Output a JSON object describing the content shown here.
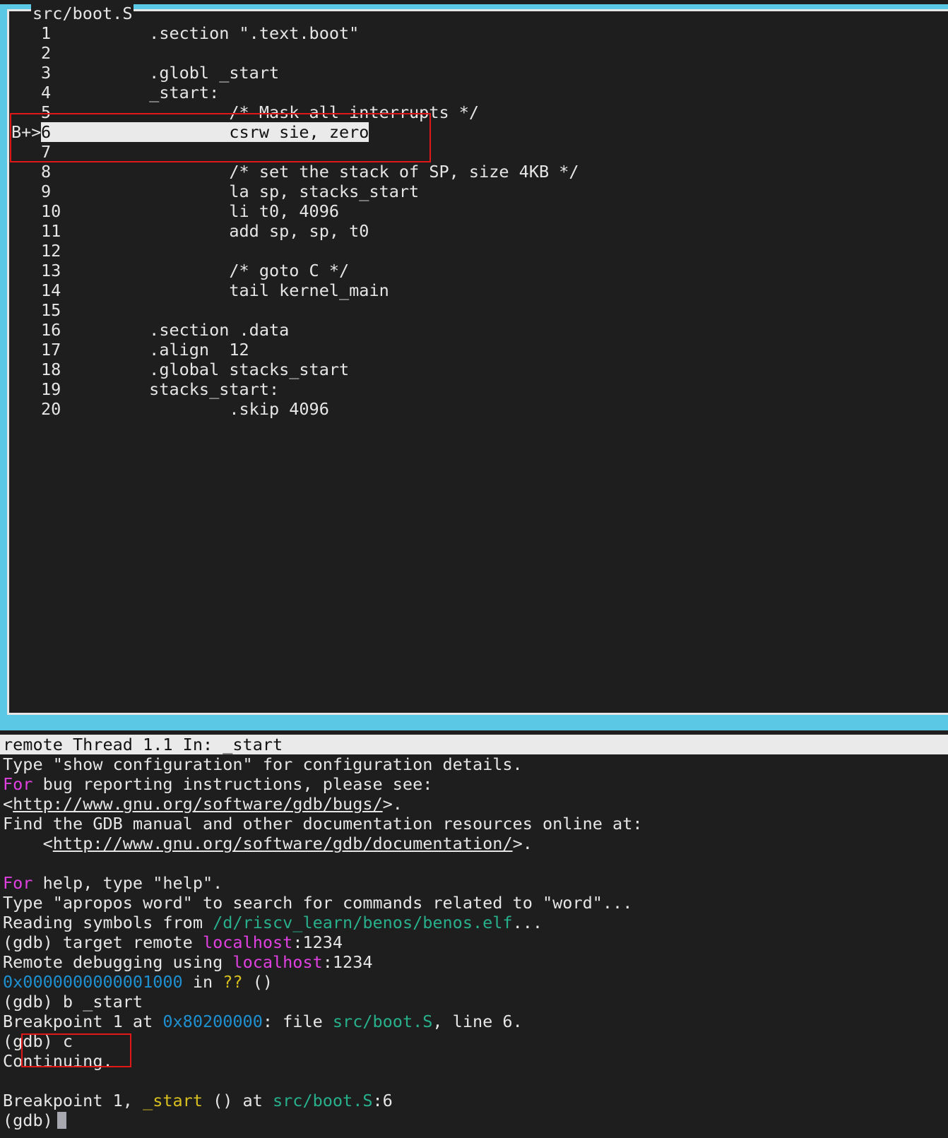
{
  "source_window": {
    "title": "src/boot.S",
    "lines": [
      {
        "num": "1",
        "marker": "",
        "code": "        .section \".text.boot\""
      },
      {
        "num": "2",
        "marker": "",
        "code": ""
      },
      {
        "num": "3",
        "marker": "",
        "code": "        .globl _start"
      },
      {
        "num": "4",
        "marker": "",
        "code": "        _start:"
      },
      {
        "num": "5",
        "marker": "",
        "code": "                /* Mask all interrupts */"
      },
      {
        "num": "6",
        "marker": "B+>",
        "code": "csrw sie, zero",
        "pad": "                "
      },
      {
        "num": "7",
        "marker": "",
        "code": ""
      },
      {
        "num": "8",
        "marker": "",
        "code": "                /* set the stack of SP, size 4KB */"
      },
      {
        "num": "9",
        "marker": "",
        "code": "                la sp, stacks_start"
      },
      {
        "num": "10",
        "marker": "",
        "code": "                li t0, 4096"
      },
      {
        "num": "11",
        "marker": "",
        "code": "                add sp, sp, t0"
      },
      {
        "num": "12",
        "marker": "",
        "code": ""
      },
      {
        "num": "13",
        "marker": "",
        "code": "                /* goto C */"
      },
      {
        "num": "14",
        "marker": "",
        "code": "                tail kernel_main"
      },
      {
        "num": "15",
        "marker": "",
        "code": ""
      },
      {
        "num": "16",
        "marker": "",
        "code": "        .section .data"
      },
      {
        "num": "17",
        "marker": "",
        "code": "        .align  12"
      },
      {
        "num": "18",
        "marker": "",
        "code": "        .global stacks_start"
      },
      {
        "num": "19",
        "marker": "",
        "code": "        stacks_start:"
      },
      {
        "num": "20",
        "marker": "",
        "code": "                .skip 4096"
      }
    ]
  },
  "status_bar": {
    "text": "remote Thread 1.1 In: _start"
  },
  "console": {
    "l1": "Type \"show configuration\" for configuration details.",
    "l2_a": "For",
    "l2_b": " bug reporting instructions, please see:",
    "l3_a": "<",
    "l3_link": "http://www.gnu.org/software/gdb/bugs/",
    "l3_b": ">.",
    "l4": "Find the GDB manual and other documentation resources online at:",
    "l5_a": "    <",
    "l5_link": "http://www.gnu.org/software/gdb/documentation/",
    "l5_b": ">.",
    "l7_a": "For",
    "l7_b": " help, type \"help\".",
    "l8": "Type \"apropos word\" to search for commands related to \"word\"...",
    "l9_a": "Reading symbols from ",
    "l9_path": "/d/riscv_learn/benos/benos.elf",
    "l9_b": "...",
    "l10_a": "(gdb) target remote ",
    "l10_host": "localhost",
    "l10_b": ":1234",
    "l11_a": "Remote debugging using ",
    "l11_host": "localhost",
    "l11_b": ":1234",
    "l12_addr": "0x0000000000001000",
    "l12_a": " in ",
    "l12_q": "??",
    "l12_b": " ()",
    "l13": "(gdb) b _start",
    "l14_a": "Breakpoint 1 at ",
    "l14_addr": "0x80200000",
    "l14_b": ": file ",
    "l14_file": "src/boot.S",
    "l14_c": ", line 6.",
    "l15": "(gdb) c",
    "l16": "Continuing.",
    "l18_a": "Breakpoint 1, ",
    "l18_fn": "_start",
    "l18_b": " () at ",
    "l18_file": "src/boot.S",
    "l18_c": ":6",
    "l19": "(gdb)"
  },
  "colors": {
    "frame": "#5bc8e6",
    "keyword": "#e040e0",
    "path": "#28b08c",
    "address": "#1e90d0",
    "highlight": "#eaeaea",
    "annotation": "#e01818"
  }
}
